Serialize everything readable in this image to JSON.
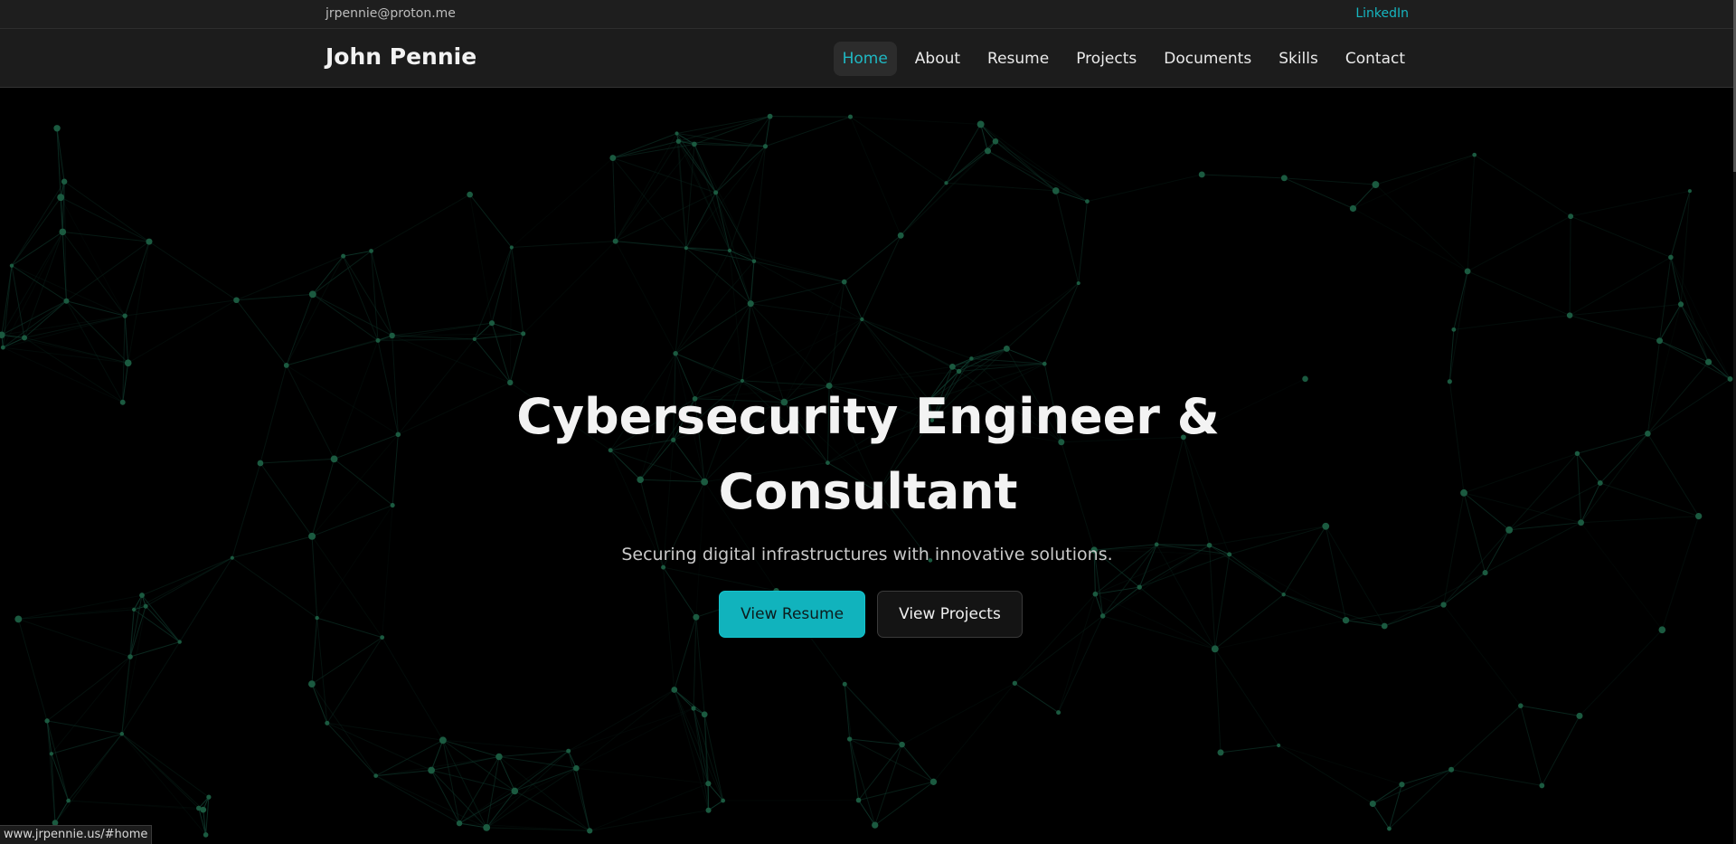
{
  "topbar": {
    "email": "jrpennie@proton.me",
    "social_link": "LinkedIn"
  },
  "header": {
    "brand": "John Pennie",
    "nav": [
      {
        "label": "Home",
        "active": true
      },
      {
        "label": "About"
      },
      {
        "label": "Resume"
      },
      {
        "label": "Projects"
      },
      {
        "label": "Documents"
      },
      {
        "label": "Skills"
      },
      {
        "label": "Contact"
      }
    ]
  },
  "hero": {
    "title_line1": "Cybersecurity Engineer &",
    "title_line2": "Consultant",
    "subtitle": "Securing digital infrastructures with innovative solutions.",
    "primary_button": "View Resume",
    "secondary_button": "View Projects"
  },
  "status_bar": {
    "url": "www.jrpennie.us/#home"
  },
  "colors": {
    "accent": "#11b3bd",
    "network_line": "#0f3b2e",
    "network_node": "#1b5a40",
    "background": "#000000"
  }
}
